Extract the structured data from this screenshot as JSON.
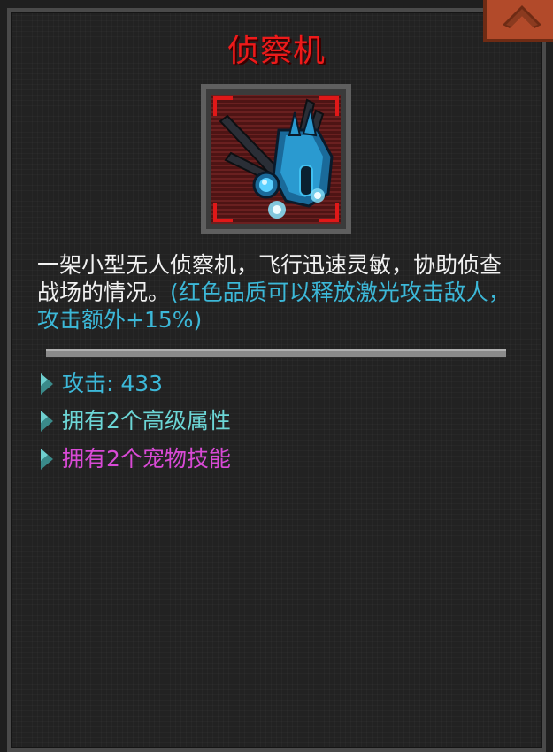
{
  "item": {
    "name": "侦察机",
    "description": "一架小型无人侦察机，飞行迅速灵敏，协助侦查战场的情况。",
    "quality_note": "(红色品质可以释放激光攻击敌人，攻击额外+15%)",
    "icon": "recon-drone-icon",
    "quality_color": "#e01818"
  },
  "stats": {
    "attack": "攻击: 433",
    "advanced_attributes": "拥有2个高级属性",
    "pet_skills": "拥有2个宠物技能"
  },
  "colors": {
    "title": "#ee1a1a",
    "note": "#3cb8d8",
    "attack": "#3cb8d8",
    "attributes": "#6cd6d6",
    "skills": "#d94ad6",
    "close_button": "#b24a2a"
  },
  "icons": {
    "close": "chevron-up-icon",
    "bullet": "triangle-bullet-icon"
  }
}
